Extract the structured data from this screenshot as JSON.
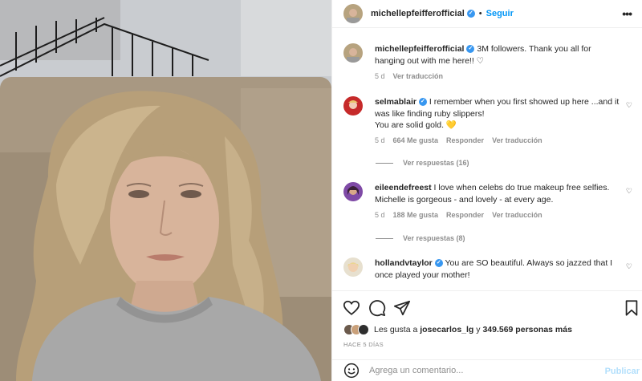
{
  "post": {
    "author": "michellepfeifferofficial",
    "follow_label": "Seguir",
    "more_label": "•••",
    "caption_text": "3M followers. Thank you all for hanging out with me here!! ♡",
    "caption_age": "5 d",
    "caption_translate": "Ver traducción"
  },
  "comments": [
    {
      "user": "selmablair",
      "text": "I remember when you first showed up here ...and it was like finding ruby slippers!",
      "text2": "You are solid gold. 💛",
      "age": "5 d",
      "likes": "664 Me gusta",
      "reply": "Responder",
      "translate": "Ver traducción",
      "replies": "Ver respuestas (16)"
    },
    {
      "user": "eileendefreest",
      "text": "I love when celebs do true makeup free selfies. Michelle is gorgeous - and lovely - at every age.",
      "age": "5 d",
      "likes": "188 Me gusta",
      "reply": "Responder",
      "translate": "Ver traducción",
      "replies": "Ver respuestas (8)"
    },
    {
      "user": "hollandvtaylor",
      "text": "You are SO beautiful. Always so jazzed that I once played your mother!"
    }
  ],
  "likes_summary": {
    "prefix": "Les gusta a",
    "user": "josecarlos_lg",
    "middle": "y",
    "count": "349.569 personas más"
  },
  "date_label": "HACE 5 DÍAS",
  "composer": {
    "placeholder": "Agrega un comentario...",
    "publish_label": "Publicar"
  },
  "colors": {
    "accent": "#0095f6",
    "verified": "#3897f0",
    "muted": "#8e8e8e"
  },
  "icons": {
    "like": "heart-icon",
    "comment": "comment-icon",
    "share": "send-icon",
    "save": "bookmark-icon",
    "emoji": "smiley-icon"
  }
}
